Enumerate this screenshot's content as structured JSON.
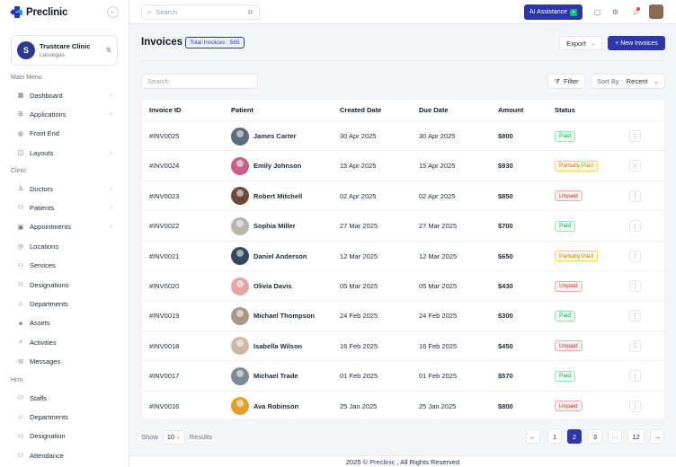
{
  "brand": {
    "name": "Preclinic",
    "colors": {
      "primary": "#2e37a4",
      "success": "#16a34a",
      "warning": "#d97706",
      "danger": "#dc2626"
    }
  },
  "clinic": {
    "name": "Trustcare Clinic",
    "location": "Lasvegas"
  },
  "sidebar": {
    "sections": [
      {
        "label": "Main Menu"
      },
      {
        "label": "Clinic"
      },
      {
        "label": "Hrm"
      }
    ],
    "main_items": [
      {
        "label": "Dashboard",
        "icon": "grid-icon",
        "glyph": "▦",
        "chevron": true
      },
      {
        "label": "Applications",
        "icon": "apps-icon",
        "glyph": "⊞",
        "chevron": true
      },
      {
        "label": "Front End",
        "icon": "globe-icon",
        "glyph": "◍",
        "chevron": false
      },
      {
        "label": "Layouts",
        "icon": "layout-icon",
        "glyph": "◫",
        "chevron": true
      }
    ],
    "clinic_items": [
      {
        "label": "Doctors",
        "icon": "doctor-icon",
        "glyph": "♙",
        "chevron": true
      },
      {
        "label": "Patients",
        "icon": "patients-icon",
        "glyph": "⚇",
        "chevron": true
      },
      {
        "label": "Appointments",
        "icon": "calendar-icon",
        "glyph": "▣",
        "chevron": true
      },
      {
        "label": "Locations",
        "icon": "location-icon",
        "glyph": "◎",
        "chevron": false
      },
      {
        "label": "Services",
        "icon": "services-icon",
        "glyph": "⚇",
        "chevron": false
      },
      {
        "label": "Designations",
        "icon": "designation-icon",
        "glyph": "⚇",
        "chevron": false
      },
      {
        "label": "Departments",
        "icon": "department-icon",
        "glyph": "⌂",
        "chevron": false
      },
      {
        "label": "Assets",
        "icon": "assets-icon",
        "glyph": "◈",
        "chevron": false
      },
      {
        "label": "Activities",
        "icon": "activity-icon",
        "glyph": "⚡",
        "chevron": false
      },
      {
        "label": "Messages",
        "icon": "message-icon",
        "glyph": "✉",
        "chevron": false
      }
    ],
    "hrm_items": [
      {
        "label": "Staffs",
        "icon": "staff-icon",
        "glyph": "⚇",
        "chevron": false
      },
      {
        "label": "Departments",
        "icon": "department-icon",
        "glyph": "⌂",
        "chevron": false
      },
      {
        "label": "Designation",
        "icon": "designation-icon",
        "glyph": "⚇",
        "chevron": false
      },
      {
        "label": "Attendance",
        "icon": "attendance-icon",
        "glyph": "⚇",
        "chevron": false
      }
    ]
  },
  "topbar": {
    "search_placeholder": "Search",
    "shortcut": "⌘",
    "ai_label": "AI Assistance"
  },
  "page": {
    "title": "Invoices",
    "total_badge": "Total Invoices : 565",
    "export_label": "Export",
    "new_label": "+ New Invoices",
    "list_search_placeholder": "Search",
    "filter_label": "Filter",
    "sort_label": "Sort By :",
    "sort_value": "Recent"
  },
  "table": {
    "columns": [
      "Invoice ID",
      "Patient",
      "Created Date",
      "Due Date",
      "Amount",
      "Status"
    ],
    "rows": [
      {
        "id": "#INV0025",
        "patient": "James Carter",
        "avatar": "#5b6b7a",
        "created": "30 Apr 2025",
        "due": "30 Apr 2025",
        "amount": "$800",
        "status": "Paid",
        "kind": "paid"
      },
      {
        "id": "#INV0024",
        "patient": "Emily Johnson",
        "avatar": "#c2618a",
        "created": "15 Apr 2025",
        "due": "15 Apr 2025",
        "amount": "$930",
        "status": "Partially Paid",
        "kind": "partial"
      },
      {
        "id": "#INV0023",
        "patient": "Robert Mitchell",
        "avatar": "#6b4a3a",
        "created": "02 Apr 2025",
        "due": "02 Apr 2025",
        "amount": "$850",
        "status": "Unpaid",
        "kind": "unpaid"
      },
      {
        "id": "#INV0022",
        "patient": "Sophia Miller",
        "avatar": "#b9b4ae",
        "created": "27 Mar 2025",
        "due": "27 Mar 2025",
        "amount": "$700",
        "status": "Paid",
        "kind": "paid"
      },
      {
        "id": "#INV0021",
        "patient": "Daniel Anderson",
        "avatar": "#34495e",
        "created": "12 Mar 2025",
        "due": "12 Mar 2025",
        "amount": "$650",
        "status": "Partially Paid",
        "kind": "partial"
      },
      {
        "id": "#INV0020",
        "patient": "Olivia Davis",
        "avatar": "#e3a5a5",
        "created": "05 Mar 2025",
        "due": "05 Mar 2025",
        "amount": "$430",
        "status": "Unpaid",
        "kind": "unpaid"
      },
      {
        "id": "#INV0019",
        "patient": "Michael Thompson",
        "avatar": "#a89888",
        "created": "24 Feb 2025",
        "due": "24 Feb 2025",
        "amount": "$300",
        "status": "Paid",
        "kind": "paid"
      },
      {
        "id": "#INV0018",
        "patient": "Isabella Wilson",
        "avatar": "#cdb8a8",
        "created": "16 Feb 2025",
        "due": "16 Feb 2025",
        "amount": "$450",
        "status": "Unpaid",
        "kind": "unpaid"
      },
      {
        "id": "#INV0017",
        "patient": "Michael Trade",
        "avatar": "#7d8a96",
        "created": "01 Feb 2025",
        "due": "01 Feb 2025",
        "amount": "$570",
        "status": "Paid",
        "kind": "paid"
      },
      {
        "id": "#INV0016",
        "patient": "Ava Robinson",
        "avatar": "#e0a030",
        "created": "25 Jan 2025",
        "due": "25 Jan 2025",
        "amount": "$800",
        "status": "Unpaid",
        "kind": "unpaid"
      }
    ]
  },
  "pagination": {
    "show_label": "Show",
    "per_page": "10",
    "results_label": "Results",
    "prev": "←",
    "pages": [
      "1",
      "2",
      "3",
      "···",
      "12"
    ],
    "active": "2",
    "next": "→"
  },
  "footer": {
    "prefix": "2025 ©",
    "brand": "Preclinic",
    "suffix": ", All Rights Reserved"
  }
}
